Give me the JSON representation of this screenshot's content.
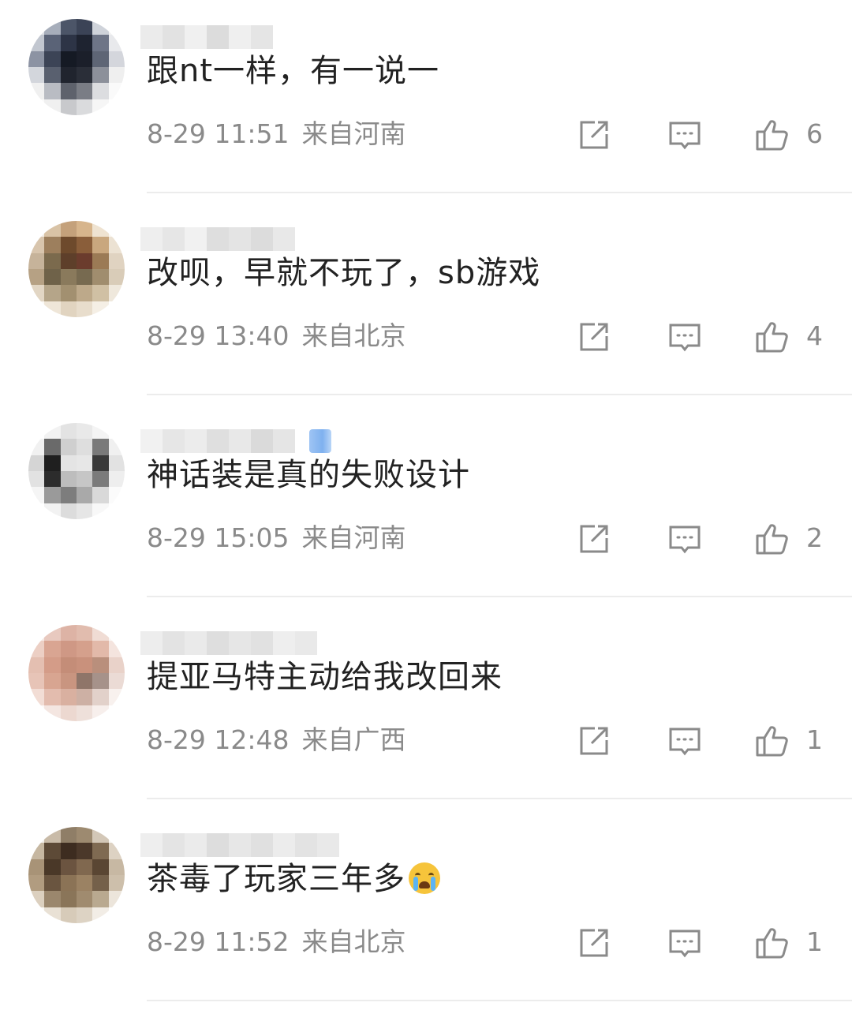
{
  "comments": [
    {
      "text": "跟nt一样，有一说一",
      "time": "8-29 11:51",
      "location": "来自河南",
      "likes": "6",
      "emoji": ""
    },
    {
      "text": "改呗，早就不玩了，sb游戏",
      "time": "8-29 13:40",
      "location": "来自北京",
      "likes": "4",
      "emoji": ""
    },
    {
      "text": "神话装是真的失败设计",
      "time": "8-29 15:05",
      "location": "来自河南",
      "likes": "2",
      "emoji": ""
    },
    {
      "text": "提亚马特主动给我改回来",
      "time": "8-29 12:48",
      "location": "来自广西",
      "likes": "1",
      "emoji": ""
    },
    {
      "text": "茶毒了玩家三年多",
      "time": "8-29 11:52",
      "location": "来自北京",
      "likes": "1",
      "emoji": "crying-face"
    }
  ],
  "icons": {
    "share": "share-icon",
    "reply": "comment-icon",
    "like": "thumbs-up-icon"
  },
  "colors": {
    "text": "#222222",
    "meta": "#8a8a8a",
    "icon": "#8a8a8a",
    "divider": "#ececec",
    "badge": "#9ec4f4"
  }
}
